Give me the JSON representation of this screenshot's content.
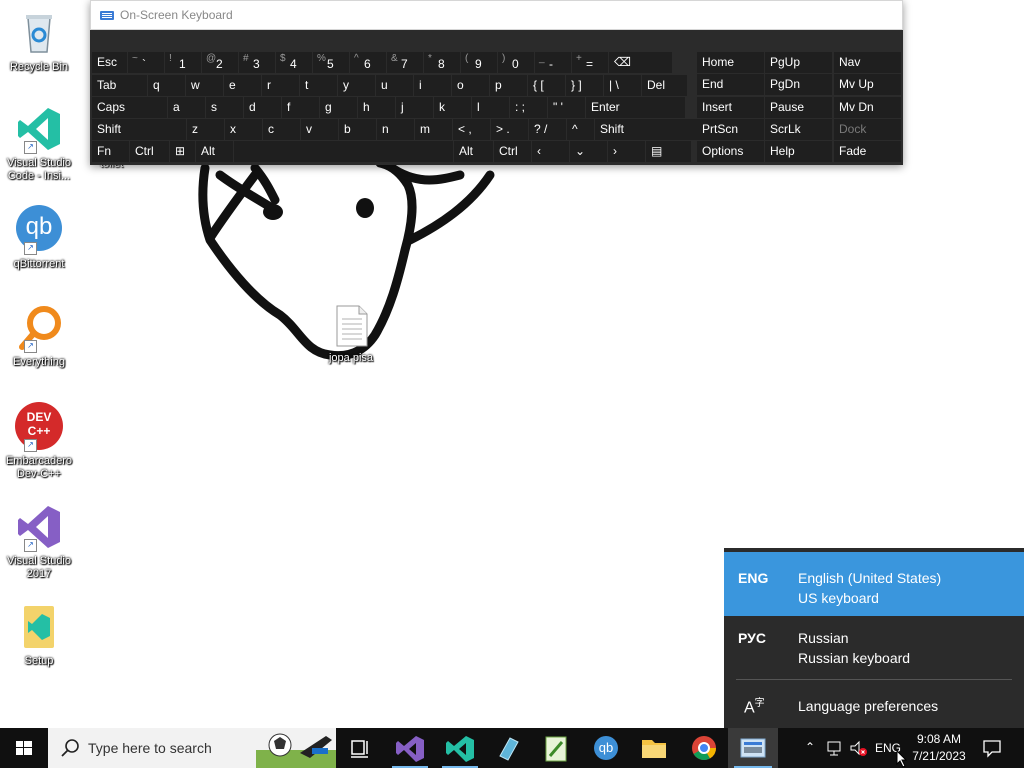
{
  "desktop": {
    "icons": [
      {
        "label": "Recycle Bin",
        "icon": "recycle-bin-icon"
      },
      {
        "label": "Visual Studio Code - Insi...",
        "icon": "vscode-insiders-icon"
      },
      {
        "label": "qBittorrent",
        "icon": "qbittorrent-icon",
        "glyph": "qb"
      },
      {
        "label": "Everything",
        "icon": "everything-search-icon"
      },
      {
        "label": "Embarcadero Dev-C++",
        "icon": "devcpp-icon",
        "glyph": "DEV C++"
      },
      {
        "label": "Visual Studio 2017",
        "icon": "visual-studio-icon"
      },
      {
        "label": "Setup",
        "icon": "setup-icon"
      }
    ],
    "file": {
      "label": "jopa pisa",
      "icon": "text-file-icon"
    },
    "hidden_label": "toilet"
  },
  "osk": {
    "title": "On-Screen Keyboard",
    "row1": [
      {
        "m": "Esc"
      },
      {
        "s": "~",
        "m": "`"
      },
      {
        "s": "!",
        "m": "1"
      },
      {
        "s": "@",
        "m": "2"
      },
      {
        "s": "#",
        "m": "3"
      },
      {
        "s": "$",
        "m": "4"
      },
      {
        "s": "%",
        "m": "5"
      },
      {
        "s": "^",
        "m": "6"
      },
      {
        "s": "&",
        "m": "7"
      },
      {
        "s": "*",
        "m": "8"
      },
      {
        "s": "(",
        "m": "9"
      },
      {
        "s": ")",
        "m": "0"
      },
      {
        "s": "_",
        "m": "-"
      },
      {
        "s": "+",
        "m": "="
      },
      {
        "m": "⌫"
      }
    ],
    "row2": [
      "Tab",
      "q",
      "w",
      "e",
      "r",
      "t",
      "y",
      "u",
      "i",
      "o",
      "p",
      "{ [",
      "} ]",
      "| \\",
      "Del"
    ],
    "row3": [
      "Caps",
      "a",
      "s",
      "d",
      "f",
      "g",
      "h",
      "j",
      "k",
      "l",
      ": ;",
      "\" '",
      "Enter"
    ],
    "row4": [
      "Shift",
      "z",
      "x",
      "c",
      "v",
      "b",
      "n",
      "m",
      "< ,",
      "> .",
      "? /",
      "^",
      "Shift"
    ],
    "row5": [
      "Fn",
      "Ctrl",
      "⊞",
      "Alt",
      "",
      "Alt",
      "Ctrl",
      "‹",
      "⌄",
      "›",
      "▤"
    ],
    "nav": [
      [
        "Home",
        "PgUp",
        "Nav"
      ],
      [
        "End",
        "PgDn",
        "Mv Up"
      ],
      [
        "Insert",
        "Pause",
        "Mv Dn"
      ],
      [
        "PrtScn",
        "ScrLk",
        "Dock"
      ],
      [
        "Options",
        "Help",
        "Fade"
      ]
    ]
  },
  "language_panel": {
    "items": [
      {
        "code": "ENG",
        "name": "English (United States)",
        "sub": "US keyboard",
        "selected": true
      },
      {
        "code": "РУС",
        "name": "Russian",
        "sub": "Russian keyboard",
        "selected": false
      }
    ],
    "preferences": "Language preferences",
    "accent": "#3a96dd"
  },
  "taskbar": {
    "search_placeholder": "Type here to search",
    "lang": "ENG",
    "time": "9:08 AM",
    "date": "7/21/2023"
  }
}
